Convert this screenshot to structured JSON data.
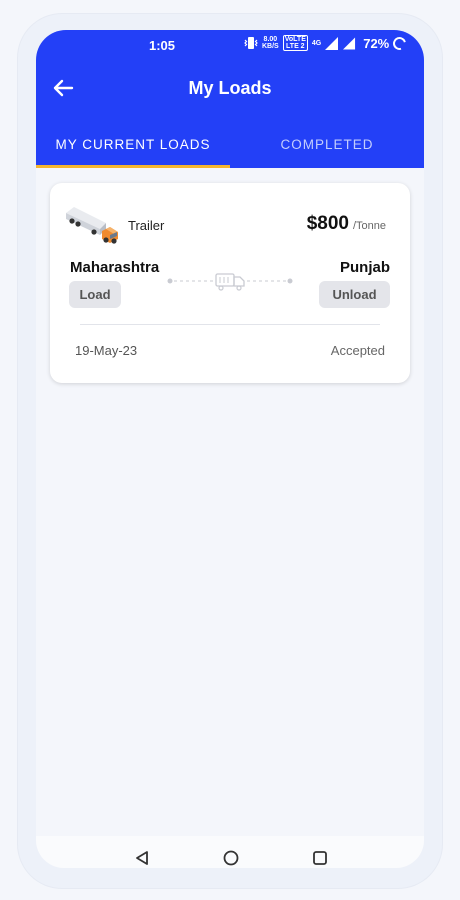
{
  "status_bar": {
    "time": "1:05",
    "net_speed_top": "8.00",
    "net_speed_bottom": "KB/S",
    "volte_top": "VoLTE",
    "volte_bottom": "LTE 2",
    "network": "4G",
    "battery": "72%"
  },
  "header": {
    "title": "My Loads",
    "accent_color": "#2340f7"
  },
  "tabs": [
    {
      "label": "MY CURRENT LOADS",
      "active": true
    },
    {
      "label": "COMPLETED",
      "active": false
    }
  ],
  "load_card": {
    "vehicle_type": "Trailer",
    "price": "$800",
    "price_unit": "/Tonne",
    "origin": "Maharashtra",
    "destination": "Punjab",
    "origin_action": "Load",
    "destination_action": "Unload",
    "date": "19-May-23",
    "status": "Accepted"
  },
  "icons": {
    "back": "arrow-left-icon",
    "route": "truck-route-icon",
    "nav_back": "triangle-back-icon",
    "nav_home": "circle-home-icon",
    "nav_recent": "square-recent-icon"
  }
}
